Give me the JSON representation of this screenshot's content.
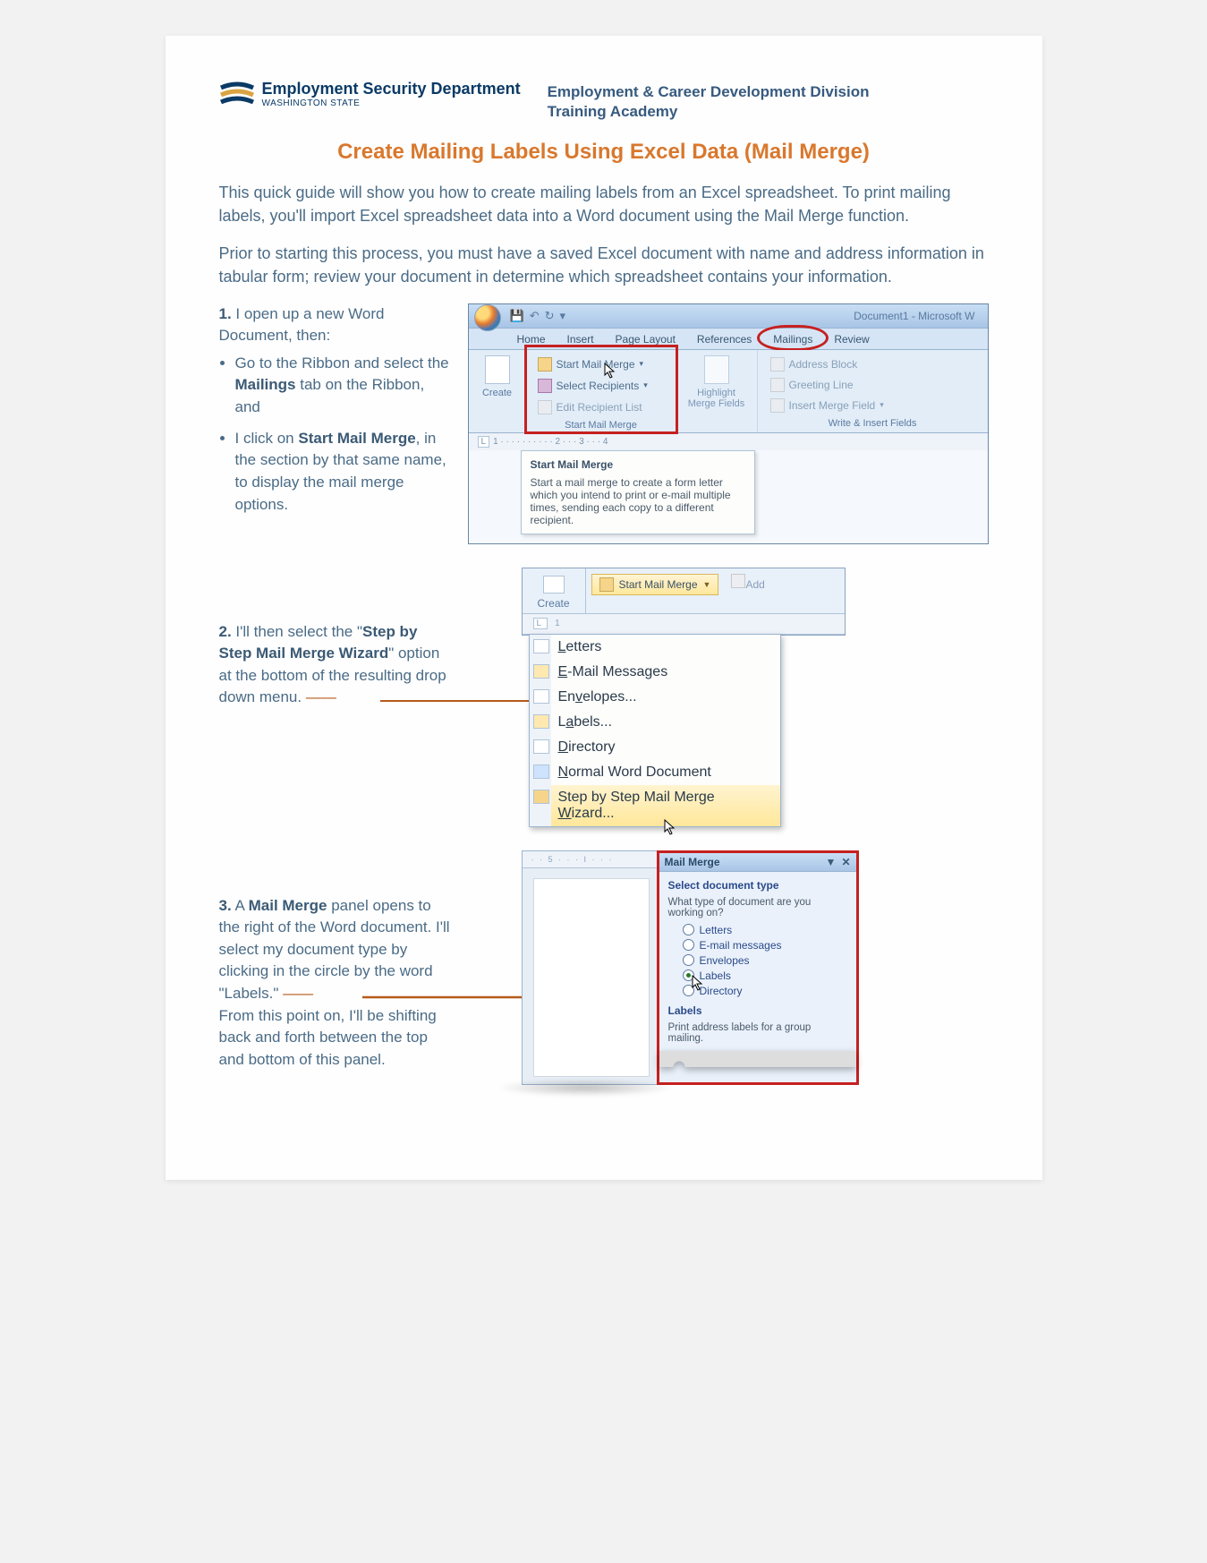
{
  "header": {
    "dept_name": "Employment Security Department",
    "dept_sub": "WASHINGTON STATE",
    "division_line1": "Employment & Career Development Division",
    "division_line2": "Training Academy"
  },
  "title": "Create Mailing Labels Using Excel Data (Mail Merge)",
  "intro1": "This quick guide will show you how to create mailing labels from an Excel spreadsheet. To print mailing labels, you'll import Excel spreadsheet data into a Word document using the Mail Merge function.",
  "intro2": "Prior to starting this process, you must have a saved Excel document with name and address information in tabular form; review your document in determine which spreadsheet contains your information.",
  "step1": {
    "num": "1.",
    "lead": "I open up a new Word Document, then:",
    "b1_pre": "Go to the Ribbon and select the ",
    "b1_bold": "Mailings",
    "b1_post": " tab on the Ribbon, and",
    "b2_pre": "I click on ",
    "b2_bold": "Start Mail Merge",
    "b2_post": ", in the section by that same name, to display the mail merge options."
  },
  "word": {
    "doc_title": "Document1 - Microsoft W",
    "tabs": [
      "Home",
      "Insert",
      "Page Layout",
      "References",
      "Mailings",
      "Review"
    ],
    "create": "Create",
    "start_mail_merge_btn": "Start Mail Merge",
    "select_recipients": "Select Recipients",
    "edit_recipient_list": "Edit Recipient List",
    "group_start": "Start Mail Merge",
    "highlight_merge_fields": "Highlight Merge Fields",
    "address_block": "Address Block",
    "greeting_line": "Greeting Line",
    "insert_merge_field": "Insert Merge Field",
    "group_write": "Write & Insert Fields",
    "tooltip_title": "Start Mail Merge",
    "tooltip_body": "Start a mail merge to create a form letter which you intend to print or e-mail multiple times, sending each copy to a different recipient."
  },
  "step2": {
    "num": "2.",
    "pre": "I'll then select the \"",
    "bold": "Step by Step Mail Merge Wizard",
    "post": "\" option at the bottom of the resulting drop down menu."
  },
  "dropdown": {
    "start_btn": "Start Mail Merge",
    "add": "Add",
    "create": "Create",
    "items": [
      {
        "label": "Letters",
        "u": "L"
      },
      {
        "label": "E-Mail Messages",
        "u": "E"
      },
      {
        "label": "Envelopes...",
        "u": "E",
        "rest": "nvelopes..."
      },
      {
        "label": "Labels...",
        "u": "L",
        "rest": "abels..."
      },
      {
        "label": "Directory",
        "u": "D"
      },
      {
        "label": "Normal Word Document",
        "u": "N"
      },
      {
        "label": "Step by Step Mail Merge Wizard...",
        "u": "W",
        "pre": "Step by Step Mail Merge ",
        "rest": "izard..."
      }
    ]
  },
  "step3": {
    "num": "3.",
    "t1_pre": "A ",
    "t1_bold": "Mail Merge",
    "t1_post": " panel opens to the right of the Word document. I'll select my document type by clicking in the circle by the word \"Labels.\"",
    "t2": "From this point on, I'll be shifting back and forth between the top and bottom of this panel."
  },
  "pane": {
    "title": "Mail Merge",
    "section": "Select document type",
    "question": "What type of document are you working on?",
    "options": [
      "Letters",
      "E-mail messages",
      "Envelopes",
      "Labels",
      "Directory"
    ],
    "selected": "Labels",
    "labels_hdr": "Labels",
    "labels_desc": "Print address labels for a group mailing."
  }
}
